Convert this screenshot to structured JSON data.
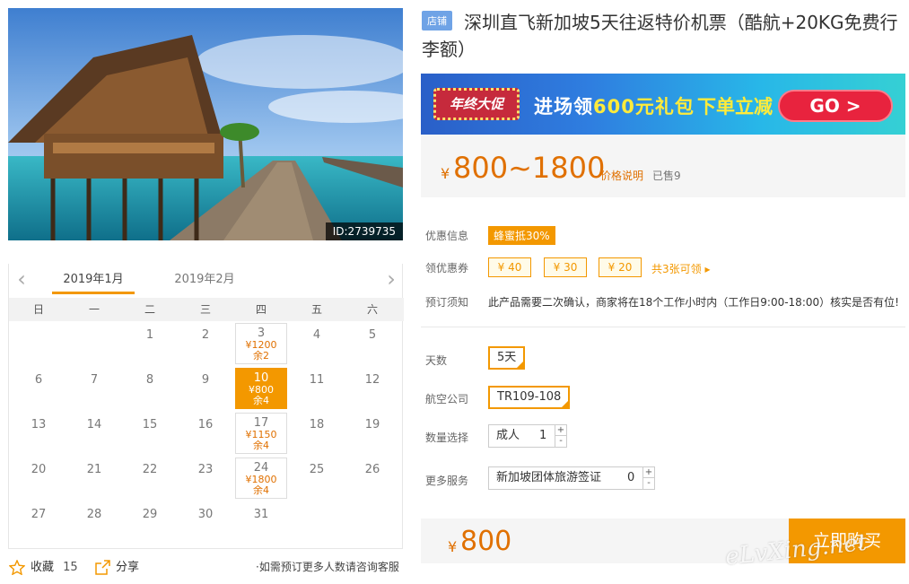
{
  "photo": {
    "id_label": "ID:2739735"
  },
  "calendar": {
    "months": [
      "2019年1月",
      "2019年2月"
    ],
    "weekdays": [
      "日",
      "一",
      "二",
      "三",
      "四",
      "五",
      "六"
    ],
    "days": [
      {
        "n": "1"
      },
      {
        "n": "2"
      },
      {
        "n": "3",
        "price": "¥1200",
        "rem": "余2"
      },
      {
        "n": "4"
      },
      {
        "n": "5"
      },
      {
        "n": "6"
      },
      {
        "n": "7"
      },
      {
        "n": "8"
      },
      {
        "n": "9"
      },
      {
        "n": "10",
        "price": "¥800",
        "rem": "余4",
        "selected": true
      },
      {
        "n": "11"
      },
      {
        "n": "12"
      },
      {
        "n": "13"
      },
      {
        "n": "14"
      },
      {
        "n": "15"
      },
      {
        "n": "16"
      },
      {
        "n": "17",
        "price": "¥1150",
        "rem": "余4"
      },
      {
        "n": "18"
      },
      {
        "n": "19"
      },
      {
        "n": "20"
      },
      {
        "n": "21"
      },
      {
        "n": "22"
      },
      {
        "n": "23"
      },
      {
        "n": "24",
        "price": "¥1800",
        "rem": "余4"
      },
      {
        "n": "25"
      },
      {
        "n": "26"
      },
      {
        "n": "27"
      },
      {
        "n": "28"
      },
      {
        "n": "29"
      },
      {
        "n": "30"
      },
      {
        "n": "31"
      }
    ],
    "first_weekday": 2
  },
  "footer": {
    "fav_label": "收藏",
    "fav_count": "15",
    "share_label": "分享",
    "contact": "如需预订更多人数请咨询客服"
  },
  "product": {
    "shop_badge": "店铺",
    "title": "深圳直飞新加坡5天往返特价机票（酷航+20KG免费行李额）"
  },
  "banner": {
    "tag": "年终大促",
    "text_a": "进场领",
    "text_hl": "600元礼包",
    "text_b": "下单立减",
    "go": "GO >"
  },
  "price": {
    "currency": "¥",
    "range": "800~1800",
    "note": "价格说明",
    "sold": "已售9"
  },
  "info": {
    "promo_label": "优惠信息",
    "promo_badge": "蜂蜜抵30%",
    "coupon_label": "领优惠券",
    "coupons": [
      "¥ 40",
      "¥ 30",
      "¥ 20"
    ],
    "coupon_more": "共3张可领 ▸",
    "notice_label": "预订须知",
    "notice": "此产品需要二次确认，商家将在18个工作小时内（工作日9:00-18:00）核实是否有位!"
  },
  "options": {
    "days_label": "天数",
    "days_value": "5天",
    "airline_label": "航空公司",
    "airline_value": "TR109-108",
    "qty_label": "数量选择",
    "qty_name": "成人",
    "qty_value": "1",
    "service_label": "更多服务",
    "service_name": "新加坡团体旅游签证",
    "service_value": "0",
    "plus": "+",
    "minus": "-"
  },
  "buy": {
    "currency": "¥",
    "price": "800",
    "button": "立即购买"
  },
  "watermark": "eLvXing.net",
  "colors": {
    "accent": "#f39800",
    "price": "#e07000"
  }
}
